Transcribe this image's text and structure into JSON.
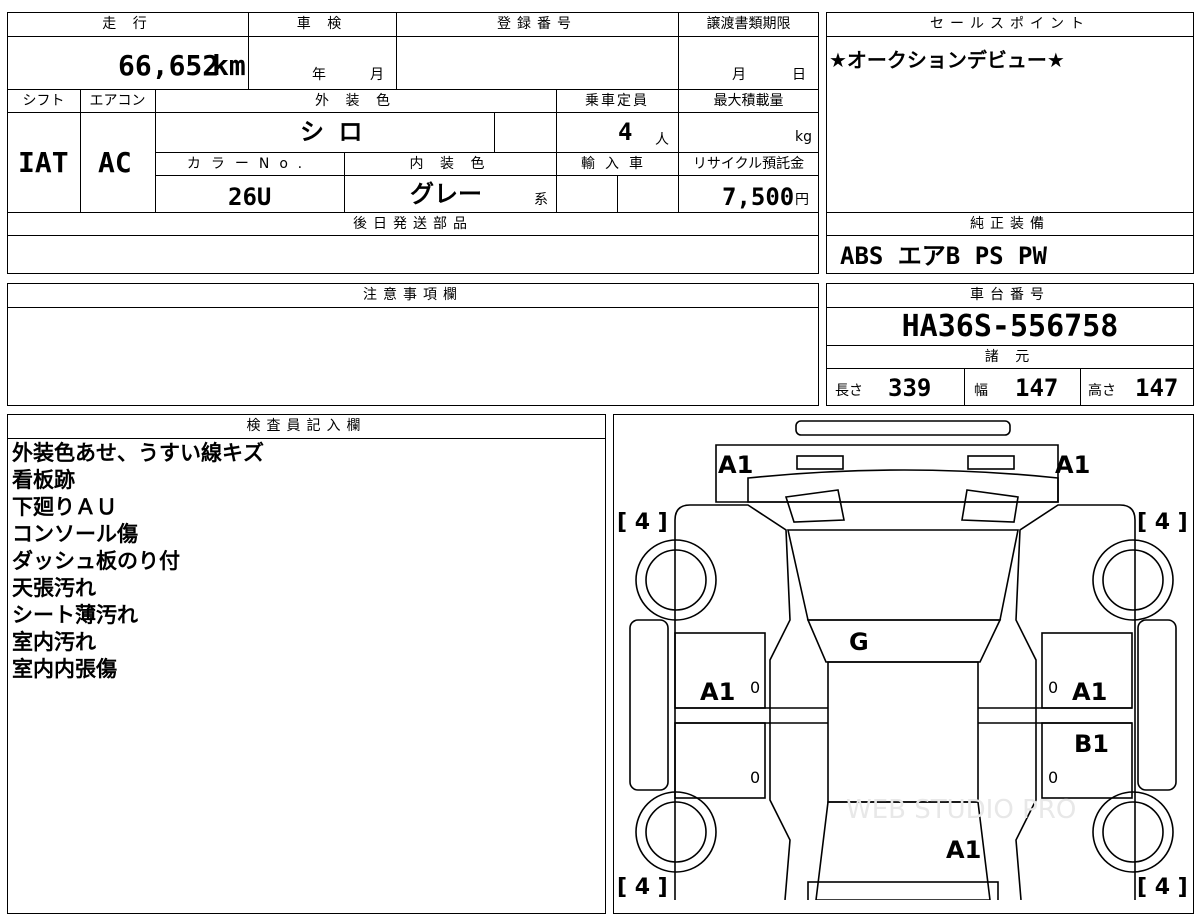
{
  "vehicle": {
    "mileage_label": "走 行",
    "mileage_value": "66,652",
    "mileage_unit": "km",
    "inspection_label": "車 検",
    "inspection_year": "年",
    "inspection_month": "月",
    "registration_label": "登録番号",
    "transfer_deadline_label": "譲渡書類期限",
    "transfer_month": "月",
    "transfer_day": "日",
    "shift_label": "シフト",
    "ac_label": "エアコン",
    "shift_value": "IAT",
    "ac_value": "AC",
    "exterior_color_label": "外 装 色",
    "exterior_color_value": "シ ロ",
    "capacity_label": "乗車定員",
    "capacity_value": "4",
    "capacity_unit": "人",
    "max_load_label": "最大積載量",
    "max_load_unit": "kg",
    "color_no_label": "カラーNo.",
    "color_no_value": "26U",
    "interior_color_label": "内 装 色",
    "interior_color_value": "グレー",
    "interior_color_suffix": "系",
    "import_label": "輸入車",
    "recycle_label": "リサイクル預託金",
    "recycle_value": "7,500",
    "recycle_unit": "円",
    "later_parts_label": "後日発送部品"
  },
  "sales_point": {
    "label": "セールスポイント",
    "text": "★オークションデビュー★"
  },
  "equipment": {
    "label": "純正装備",
    "value": "ABS エアB PS PW"
  },
  "notes": {
    "label": "注意事項欄"
  },
  "chassis": {
    "label": "車台番号",
    "value": "HA36S-556758",
    "spec_label": "諸 元",
    "length_label": "長さ",
    "length_value": "339",
    "width_label": "幅",
    "width_value": "147",
    "height_label": "高さ",
    "height_value": "147"
  },
  "inspector": {
    "label": "検査員記入欄",
    "lines": [
      "外装色あせ、うすい線キズ",
      "看板跡",
      "下廻りＡＵ",
      "コンソール傷",
      "ダッシュ板のり付",
      "天張汚れ",
      "シート薄汚れ",
      "室内汚れ",
      "室内内張傷"
    ]
  },
  "diagram": {
    "marks": {
      "front_left": "A1",
      "front_right": "A1",
      "windshield": "G",
      "left_door": "A1",
      "right_front_door": "A1",
      "right_rear_door": "B1",
      "rear": "A1",
      "tire_tl": "[ 4 ]",
      "tire_tr": "[ 4 ]",
      "tire_bl": "[ 4 ]",
      "tire_br": "[ 4 ]",
      "zero_1": "0",
      "zero_2": "0",
      "zero_3": "0",
      "zero_4": "0"
    },
    "watermark": "WEB STUDIO PRO"
  }
}
